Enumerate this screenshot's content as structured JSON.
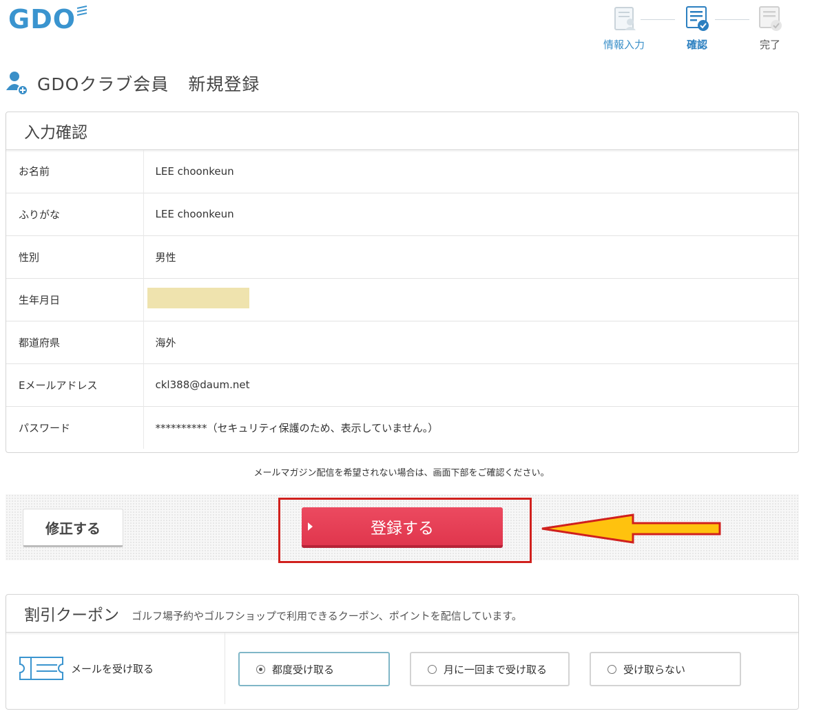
{
  "logo": {
    "text": "GDO"
  },
  "steps": [
    {
      "label": "情報入力",
      "icon": "form-entry-icon",
      "state": "done",
      "color": "#3a8fc8"
    },
    {
      "label": "確認",
      "icon": "confirm-form-icon",
      "state": "current",
      "color": "#2b7fc0"
    },
    {
      "label": "完了",
      "icon": "complete-form-icon",
      "state": "pending",
      "color": "#555555"
    }
  ],
  "page": {
    "title": "GDOクラブ会員",
    "subtitle": "新規登録",
    "icon": "add-user-icon"
  },
  "confirm": {
    "heading": "入力確認",
    "rows": [
      {
        "key": "お名前",
        "value": "LEE choonkeun"
      },
      {
        "key": "ふりがな",
        "value": "LEE choonkeun"
      },
      {
        "key": "性別",
        "value": "男性"
      },
      {
        "key": "生年月日",
        "value": ""
      },
      {
        "key": "都道府県",
        "value": "海外"
      },
      {
        "key": "Eメールアドレス",
        "value": "ckl388@daum.net"
      },
      {
        "key": "パスワード",
        "value": "**********（セキュリティ保護のため、表示していません。）"
      }
    ]
  },
  "note": "メールマガジン配信を希望されない場合は、画面下部をご確認ください。",
  "actions": {
    "edit_label": "修正する",
    "register_label": "登録する",
    "register_color": "#e43e55",
    "highlight_color": "#d0201d",
    "arrow_color": "#ffc20e"
  },
  "coupon": {
    "heading": "割引クーポン",
    "description": "ゴルフ場予約やゴルフショップで利用できるクーポン、ポイントを配信しています。",
    "row_label": "メールを受け取る",
    "options": [
      {
        "label": "都度受け取る",
        "selected": true
      },
      {
        "label": "月に一回まで受け取る",
        "selected": false
      },
      {
        "label": "受け取らない",
        "selected": false
      }
    ]
  }
}
